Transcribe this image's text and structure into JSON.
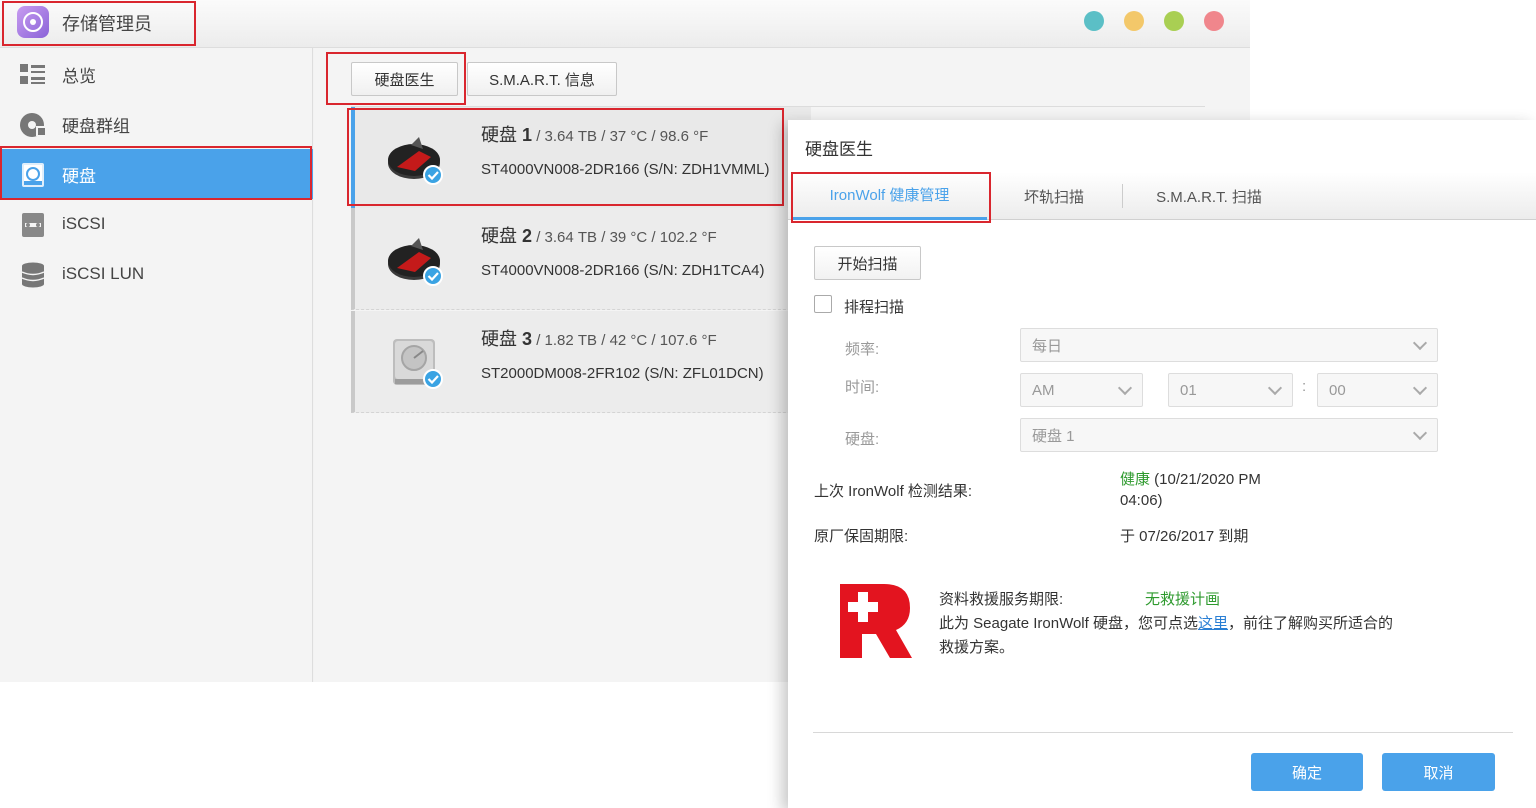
{
  "app": {
    "title": "存储管理员",
    "window_dots": [
      "#5bbfc6",
      "#f3c86a",
      "#a9cf53",
      "#f0868c"
    ]
  },
  "sidebar": {
    "items": [
      {
        "label": "总览",
        "icon": "list-icon"
      },
      {
        "label": "硬盘群组",
        "icon": "disk-group-icon"
      },
      {
        "label": "硬盘",
        "icon": "drive-icon",
        "active": true
      },
      {
        "label": "iSCSI",
        "icon": "iscsi-icon"
      },
      {
        "label": "iSCSI LUN",
        "icon": "database-icon"
      }
    ]
  },
  "toolbar": {
    "disk_doctor": "硬盘医生",
    "smart_info": "S.M.A.R.T. 信息"
  },
  "disks": [
    {
      "name": "硬盘",
      "num": "1",
      "info": " / 3.64 TB / 37 °C / 98.6 °F",
      "model": "ST4000VN008-2DR166 (S/N: ZDH1VMML)",
      "type": "ironwolf"
    },
    {
      "name": "硬盘",
      "num": "2",
      "info": " / 3.64 TB / 39 °C / 102.2 °F",
      "model": "ST4000VN008-2DR166 (S/N: ZDH1TCA4)",
      "type": "ironwolf"
    },
    {
      "name": "硬盘",
      "num": "3",
      "info": " / 1.82 TB / 42 °C / 107.6 °F",
      "model": "ST2000DM008-2FR102 (S/N: ZFL01DCN)",
      "type": "generic"
    }
  ],
  "dialog": {
    "title": "硬盘医生",
    "tabs": [
      "IronWolf 健康管理",
      "坏轨扫描",
      "S.M.A.R.T. 扫描"
    ],
    "start_scan": "开始扫描",
    "schedule_label": "排程扫描",
    "frequency_label": "频率:",
    "frequency_value": "每日",
    "time_label": "时间:",
    "ampm_value": "AM",
    "hour_value": "01",
    "time_sep": ":",
    "minute_value": "00",
    "disk_label": "硬盘:",
    "disk_value": "硬盘 1",
    "last_result_label": "上次 IronWolf 检测结果:",
    "last_result_status": "健康",
    "last_result_time_a": " (10/21/2020 PM",
    "last_result_time_b": "04:06)",
    "warranty_label": "原厂保固期限:",
    "warranty_value": "于 07/26/2017 到期",
    "rescue_label": "资料救援服务期限:",
    "rescue_value": "无救援计画",
    "rescue_text_a": "此为 Seagate IronWolf 硬盘，您可点选",
    "rescue_link": "这里",
    "rescue_text_b": "，前往了解购买所适合的",
    "rescue_text_c": "救援方案。",
    "ok": "确定",
    "cancel": "取消",
    "status_color": "#2e9a2e",
    "logo_color": "#e3141f"
  }
}
